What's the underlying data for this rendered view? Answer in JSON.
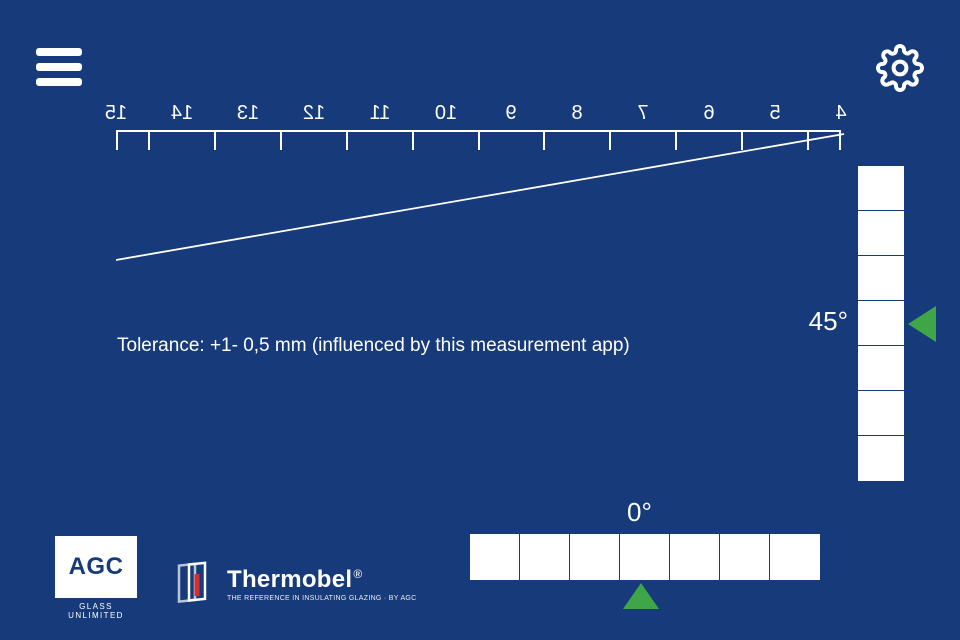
{
  "ruler": {
    "labels": [
      "15",
      "14",
      "13",
      "12",
      "11",
      "10",
      "9",
      "8",
      "7",
      "6",
      "5",
      "4"
    ]
  },
  "tolerance_text": "Tolerance: +1- 0,5 mm (influenced by this measurement app)",
  "angles": {
    "vertical": "45°",
    "horizontal": "0°"
  },
  "logos": {
    "agc": "AGC",
    "agc_sub": "GLASS UNLIMITED",
    "thermobel": "Thermobel",
    "thermobel_tag": "THE REFERENCE IN INSULATING GLAZING · BY AGC"
  },
  "scale_cells": {
    "vertical": 7,
    "horizontal": 7
  }
}
